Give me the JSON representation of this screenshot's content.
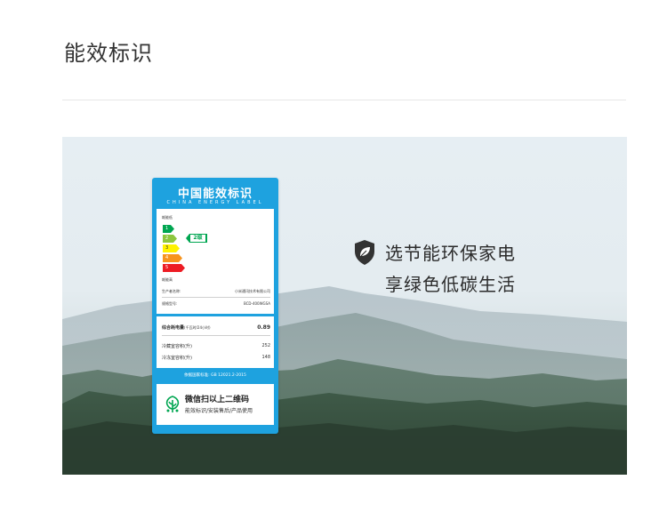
{
  "page": {
    "title": "能效标识"
  },
  "energy_label": {
    "title": "中国能效标识",
    "subtitle": "CHINA ENERGY LABEL",
    "grade_scale_top": "耗能低",
    "grade_scale_bottom": "耗能高",
    "grades": [
      {
        "label": "1",
        "color": "#00a651"
      },
      {
        "label": "2",
        "color": "#8dc63f"
      },
      {
        "label": "3",
        "color": "#fff200"
      },
      {
        "label": "4",
        "color": "#f7941d"
      },
      {
        "label": "5",
        "color": "#ed1c24"
      }
    ],
    "current_grade": "2级",
    "manufacturer_label": "生产者名称:",
    "manufacturer_value": "小米通讯技术有限公司",
    "model_label": "规格型号:",
    "model_value": "BCD-400WGSA",
    "consumption_label": "综合耗电量",
    "consumption_note": "(千瓦时/24小时)",
    "consumption_value": "0.89",
    "fridge_label": "冷藏室容积(升)",
    "fridge_value": "252",
    "freezer_label": "冷冻室容积(升)",
    "freezer_value": "148",
    "standard": "依据国家标准: GB 12021.2-2015",
    "qr_main": "微信扫以上二维码",
    "qr_sub": "能效标识/安装售后/产品使用"
  },
  "slogan": {
    "line1": "选节能环保家电",
    "line2": "享绿色低碳生活"
  },
  "colors": {
    "label_blue": "#1ea2df",
    "grade_green": "#00a651",
    "slogan_icon": "#333333"
  },
  "icons": {
    "shield": "shield-leaf-icon",
    "qr": "leaf-logo-icon"
  }
}
